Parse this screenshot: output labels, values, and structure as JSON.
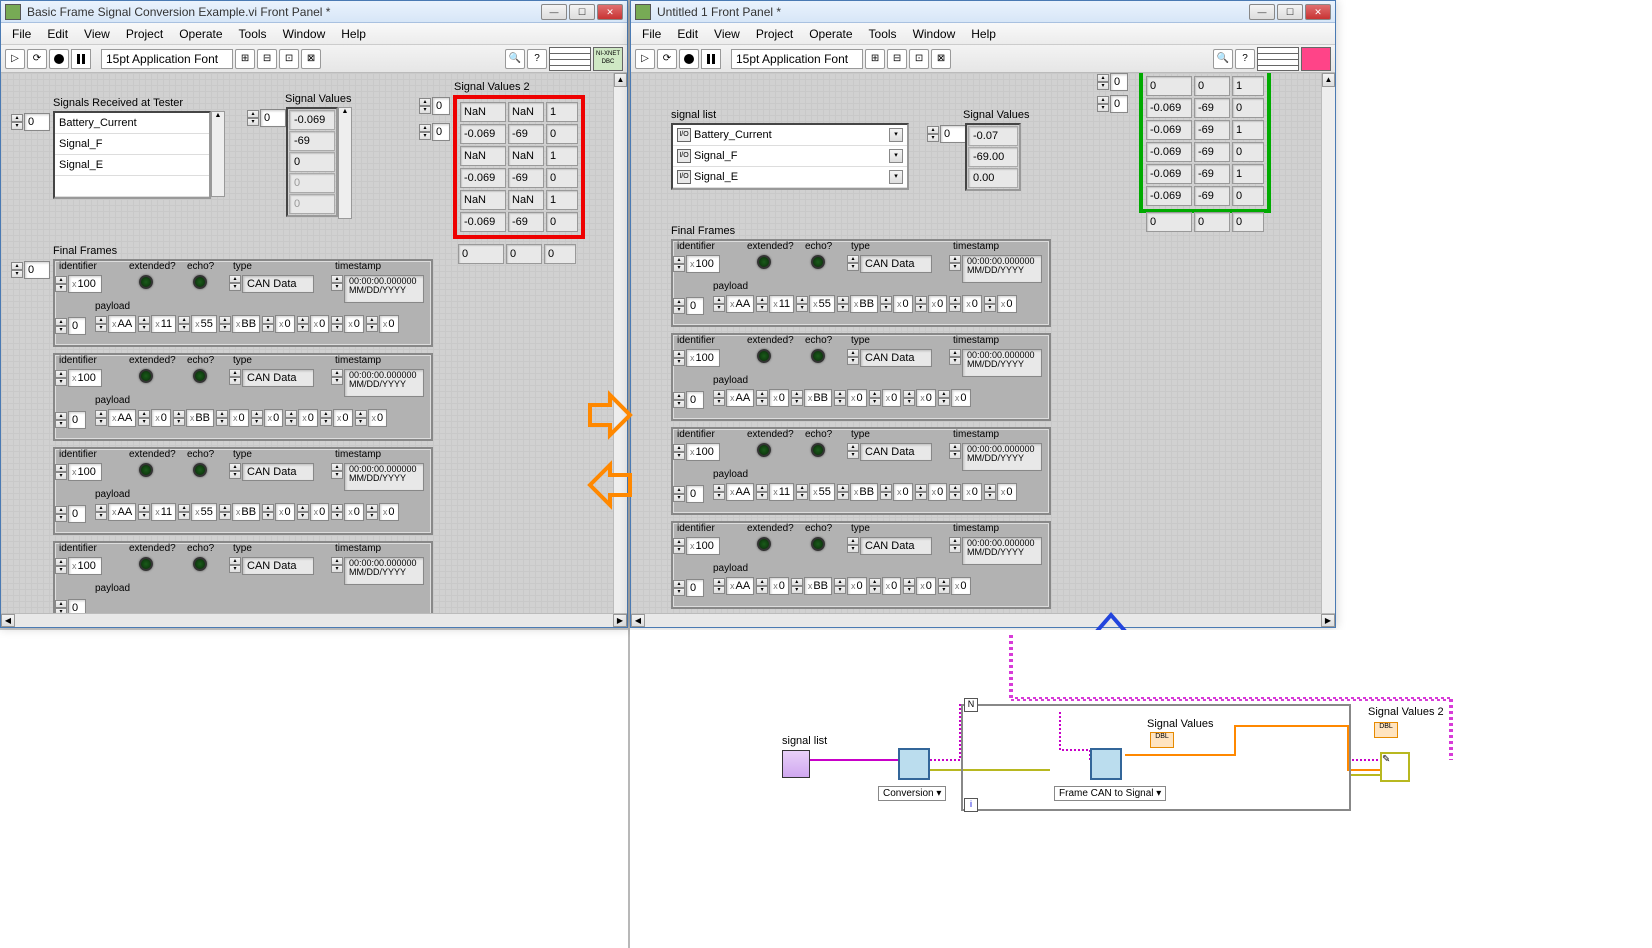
{
  "menus": [
    "File",
    "Edit",
    "View",
    "Project",
    "Operate",
    "Tools",
    "Window",
    "Help"
  ],
  "font": "15pt Application Font",
  "left": {
    "title": "Basic Frame Signal Conversion Example.vi Front Panel *",
    "signals_label": "Signals Received at Tester",
    "signals_idx": "0",
    "signals": [
      "Battery_Current",
      "Signal_F",
      "Signal_E",
      ""
    ],
    "sigvals_label": "Signal Values",
    "sigvals_idx": "0",
    "sigvals": [
      "-0.069",
      "-69",
      "0",
      "0",
      "0"
    ],
    "sv2_label": "Signal Values 2",
    "sv2_idx0": "0",
    "sv2_idx1": "0",
    "sv2": [
      [
        "NaN",
        "NaN",
        "1"
      ],
      [
        "-0.069",
        "-69",
        "0"
      ],
      [
        "NaN",
        "NaN",
        "1"
      ],
      [
        "-0.069",
        "-69",
        "0"
      ],
      [
        "NaN",
        "NaN",
        "1"
      ],
      [
        "-0.069",
        "-69",
        "0"
      ],
      [
        "0",
        "0",
        "0"
      ]
    ],
    "frames_label": "Final Frames",
    "frames_idx": "0",
    "frames": [
      {
        "id": "100",
        "type": "CAN Data",
        "ts1": "00:00:00.000000",
        "ts2": "MM/DD/YYYY",
        "pidx": "0",
        "payload": [
          "AA",
          "11",
          "55",
          "BB",
          "0",
          "0",
          "0",
          "0"
        ]
      },
      {
        "id": "100",
        "type": "CAN Data",
        "ts1": "00:00:00.000000",
        "ts2": "MM/DD/YYYY",
        "pidx": "0",
        "payload": [
          "AA",
          "0",
          "BB",
          "0",
          "0",
          "0",
          "0",
          "0"
        ]
      },
      {
        "id": "100",
        "type": "CAN Data",
        "ts1": "00:00:00.000000",
        "ts2": "MM/DD/YYYY",
        "pidx": "0",
        "payload": [
          "AA",
          "11",
          "55",
          "BB",
          "0",
          "0",
          "0",
          "0"
        ]
      },
      {
        "id": "100",
        "type": "CAN Data",
        "ts1": "00:00:00.000000",
        "ts2": "MM/DD/YYYY",
        "pidx": "0",
        "payload": [
          "",
          "",
          "",
          "",
          "",
          "",
          "",
          ""
        ]
      }
    ]
  },
  "right": {
    "title": "Untitled 1 Front Panel *",
    "signals_label": "signal list",
    "signals": [
      "Battery_Current",
      "Signal_F",
      "Signal_E"
    ],
    "sigvals_label": "Signal Values",
    "sigvals_idx": "0",
    "sigvals": [
      "-0.07",
      "-69.00",
      "0.00"
    ],
    "sv2_idx0": "0",
    "sv2_idx1": "0",
    "sv2": [
      [
        "0",
        "0",
        "1"
      ],
      [
        "-0.069",
        "-69",
        "0"
      ],
      [
        "-0.069",
        "-69",
        "1"
      ],
      [
        "-0.069",
        "-69",
        "0"
      ],
      [
        "-0.069",
        "-69",
        "1"
      ],
      [
        "-0.069",
        "-69",
        "0"
      ],
      [
        "0",
        "0",
        "0"
      ]
    ],
    "frames_label": "Final Frames",
    "frames": [
      {
        "id": "100",
        "type": "CAN Data",
        "ts1": "00:00:00.000000",
        "ts2": "MM/DD/YYYY",
        "pidx": "0",
        "payload": [
          "AA",
          "11",
          "55",
          "BB",
          "0",
          "0",
          "0",
          "0"
        ]
      },
      {
        "id": "100",
        "type": "CAN Data",
        "ts1": "00:00:00.000000",
        "ts2": "MM/DD/YYYY",
        "pidx": "0",
        "payload": [
          "AA",
          "0",
          "BB",
          "0",
          "0",
          "0",
          "0"
        ]
      },
      {
        "id": "100",
        "type": "CAN Data",
        "ts1": "00:00:00.000000",
        "ts2": "MM/DD/YYYY",
        "pidx": "0",
        "payload": [
          "AA",
          "11",
          "55",
          "BB",
          "0",
          "0",
          "0",
          "0"
        ]
      },
      {
        "id": "100",
        "type": "CAN Data",
        "ts1": "00:00:00.000000",
        "ts2": "MM/DD/YYYY",
        "pidx": "0",
        "payload": [
          "AA",
          "0",
          "BB",
          "0",
          "0",
          "0",
          "0"
        ]
      }
    ]
  },
  "cluster_labels": {
    "identifier": "identifier",
    "extended": "extended?",
    "echo": "echo?",
    "type": "type",
    "timestamp": "timestamp",
    "payload": "payload"
  },
  "bd": {
    "signal_list": "signal list",
    "conversion": "Conversion",
    "frame_can": "Frame CAN to Signal",
    "sigvals": "Signal Values",
    "sigvals2": "Signal Values 2",
    "n": "N",
    "i": "i"
  }
}
